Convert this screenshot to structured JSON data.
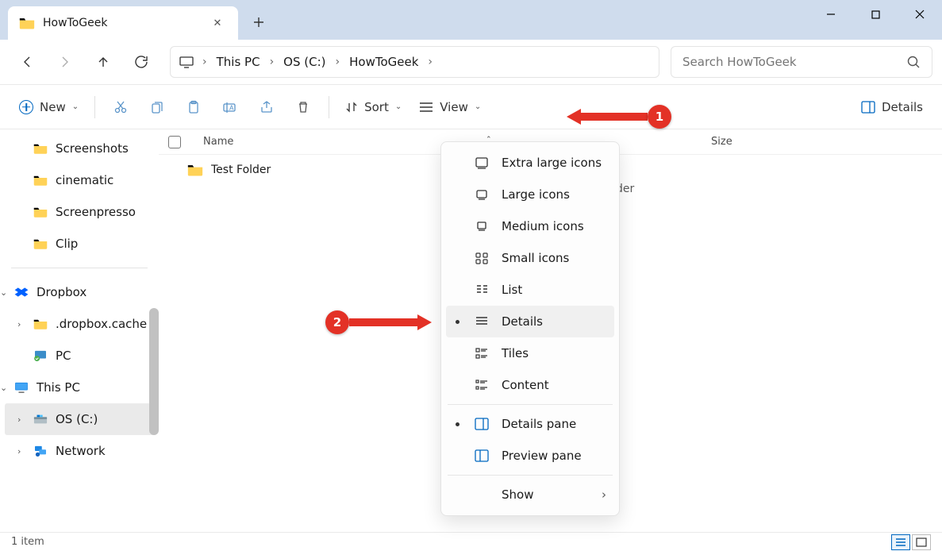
{
  "tab": {
    "title": "HowToGeek"
  },
  "breadcrumb": {
    "root": "This PC",
    "drive": "OS (C:)",
    "folder": "HowToGeek"
  },
  "search": {
    "placeholder": "Search HowToGeek"
  },
  "toolbar": {
    "new": "New",
    "sort": "Sort",
    "view": "View",
    "details": "Details"
  },
  "sidebar": {
    "items": [
      {
        "label": "Screenshots"
      },
      {
        "label": "cinematic"
      },
      {
        "label": "Screenpresso"
      },
      {
        "label": "Clip"
      }
    ],
    "dropbox": "Dropbox",
    "dropbox_cache": ".dropbox.cache",
    "pc_link": "PC",
    "this_pc": "This PC",
    "os_c": "OS (C:)",
    "network": "Network"
  },
  "columns": {
    "name": "Name",
    "size": "Size"
  },
  "rows": [
    {
      "name": "Test Folder"
    }
  ],
  "peek": "der",
  "view_menu": {
    "extra_large": "Extra large icons",
    "large": "Large icons",
    "medium": "Medium icons",
    "small": "Small icons",
    "list": "List",
    "details": "Details",
    "tiles": "Tiles",
    "content": "Content",
    "details_pane": "Details pane",
    "preview_pane": "Preview pane",
    "show": "Show"
  },
  "status": {
    "count": "1 item"
  },
  "callouts": {
    "one": "1",
    "two": "2"
  }
}
